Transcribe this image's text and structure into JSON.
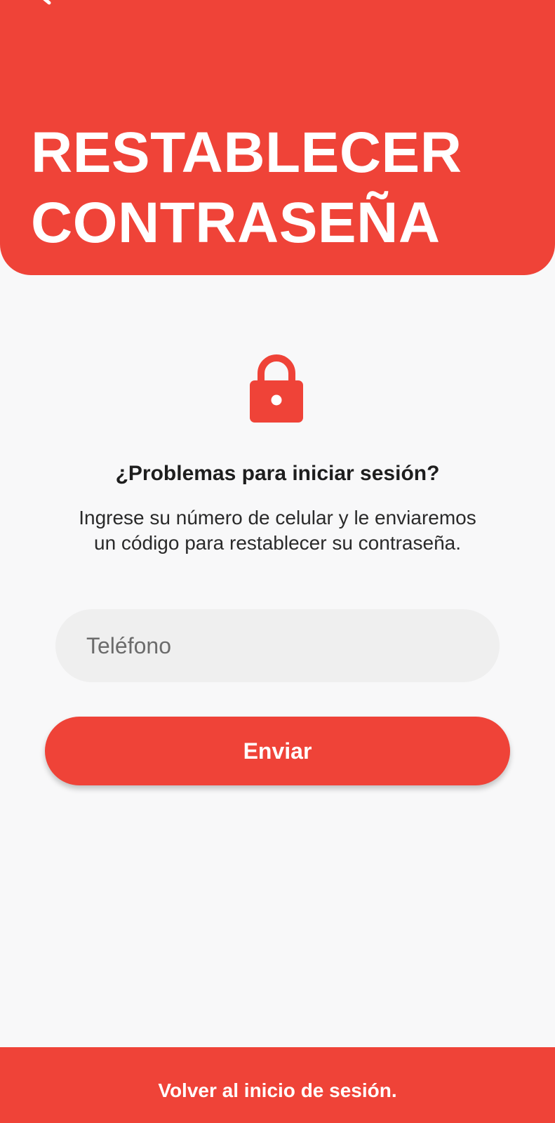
{
  "header": {
    "title_line1": "RESTABLECER",
    "title_line2": "CONTRASEÑA",
    "back_icon": "back-arrow-icon"
  },
  "main": {
    "icon": "lock-icon",
    "heading": "¿Problemas para iniciar sesión?",
    "description": "Ingrese su número de celular y le enviaremos un código para restablecer su contraseña.",
    "phone": {
      "placeholder": "Teléfono",
      "value": ""
    },
    "send_label": "Enviar"
  },
  "footer": {
    "link_label": "Volver al inicio de sesión."
  },
  "colors": {
    "accent": "#ef4338",
    "background": "#f8f8f9",
    "input_background": "#efefef"
  }
}
